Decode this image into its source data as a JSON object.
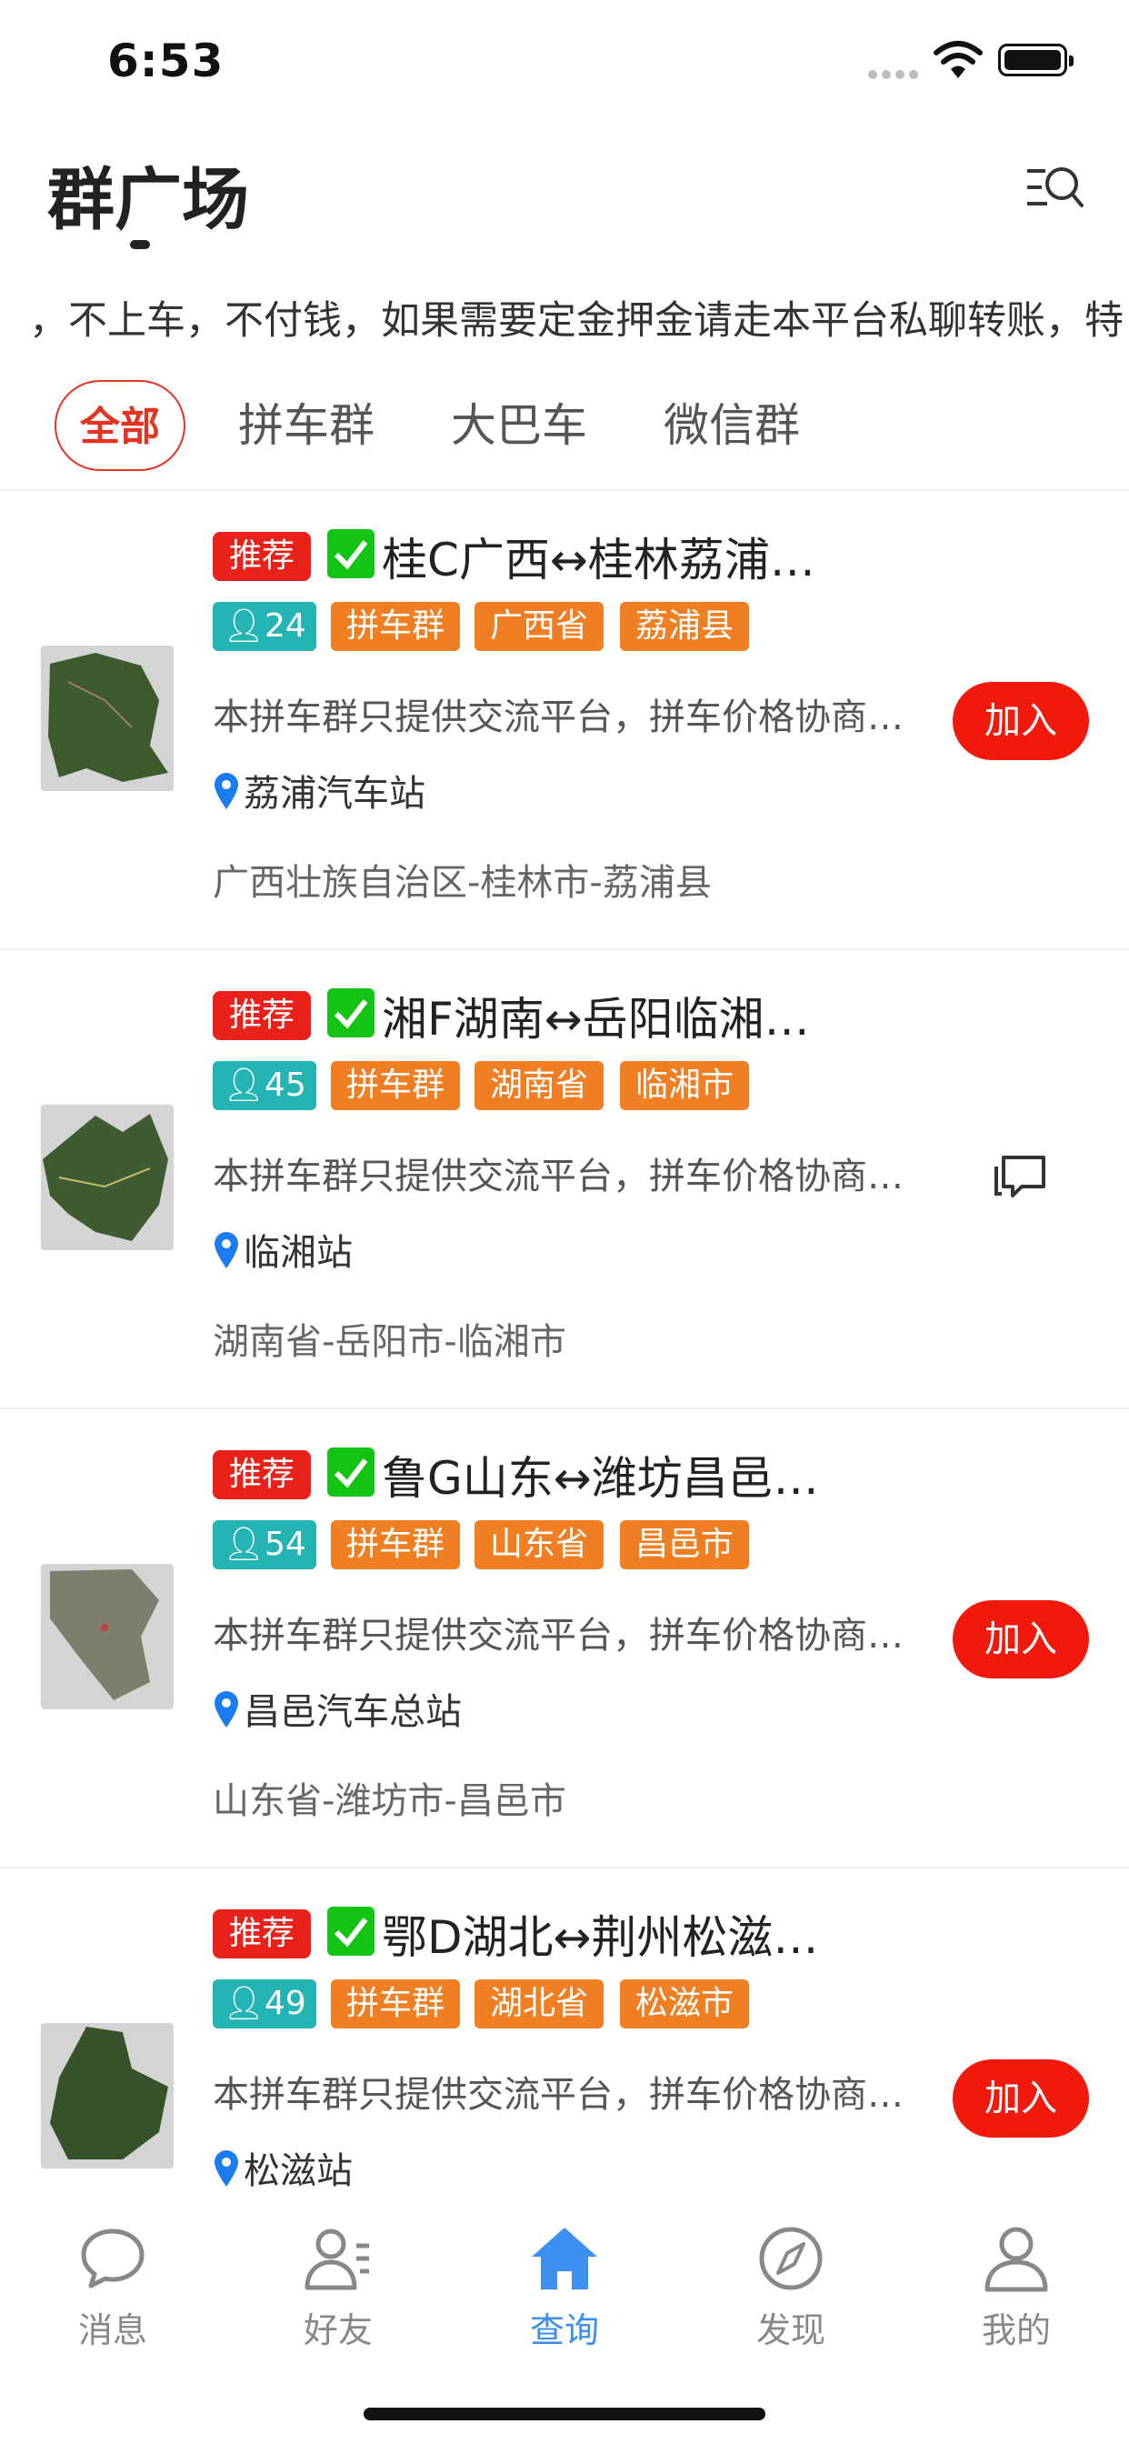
{
  "status_bar": {
    "time": "6:53"
  },
  "header": {
    "title": "群广场"
  },
  "notice": {
    "text": "，不上车，不付钱，如果需要定金押金请走本平台私聊转账，特"
  },
  "tabs": [
    {
      "label": "全部",
      "active": true
    },
    {
      "label": "拼车群",
      "active": false
    },
    {
      "label": "大巴车",
      "active": false
    },
    {
      "label": "微信群",
      "active": false
    }
  ],
  "groups": [
    {
      "badge": "推荐",
      "title": "桂C广西↔桂林荔浦…",
      "count": "24",
      "tags": [
        "拼车群",
        "广西省",
        "荔浦县"
      ],
      "description": "本拼车群只提供交流平台，拼车价格协商…",
      "station": "荔浦汽车站",
      "region": "广西壮族自治区-桂林市-荔浦县",
      "action": "加入",
      "map_color": "#3d5a2e"
    },
    {
      "badge": "推荐",
      "title": "湘F湖南↔岳阳临湘…",
      "count": "45",
      "tags": [
        "拼车群",
        "湖南省",
        "临湘市"
      ],
      "description": "本拼车群只提供交流平台，拼车价格协商…",
      "station": "临湘站",
      "region": "湖南省-岳阳市-临湘市",
      "action": "chat-icon",
      "map_color": "#3f5b32"
    },
    {
      "badge": "推荐",
      "title": "鲁G山东↔潍坊昌邑…",
      "count": "54",
      "tags": [
        "拼车群",
        "山东省",
        "昌邑市"
      ],
      "description": "本拼车群只提供交流平台，拼车价格协商…",
      "station": "昌邑汽车总站",
      "region": "山东省-潍坊市-昌邑市",
      "action": "加入",
      "map_color": "#7d7f6c"
    },
    {
      "badge": "推荐",
      "title": "鄂D湖北↔荆州松滋…",
      "count": "49",
      "tags": [
        "拼车群",
        "湖北省",
        "松滋市"
      ],
      "description": "本拼车群只提供交流平台，拼车价格协商…",
      "station": "松滋站",
      "region": "",
      "action": "加入",
      "map_color": "#35522a"
    }
  ],
  "tabbar": [
    {
      "label": "消息",
      "icon": "message-icon",
      "active": false
    },
    {
      "label": "好友",
      "icon": "friends-icon",
      "active": false
    },
    {
      "label": "查询",
      "icon": "home-icon",
      "active": true
    },
    {
      "label": "发现",
      "icon": "compass-icon",
      "active": false
    },
    {
      "label": "我的",
      "icon": "profile-icon",
      "active": false
    }
  ],
  "colors": {
    "accent_red": "#e8221a",
    "teal": "#25b4b4",
    "orange": "#f07e22",
    "active_blue": "#3d8ff0"
  }
}
